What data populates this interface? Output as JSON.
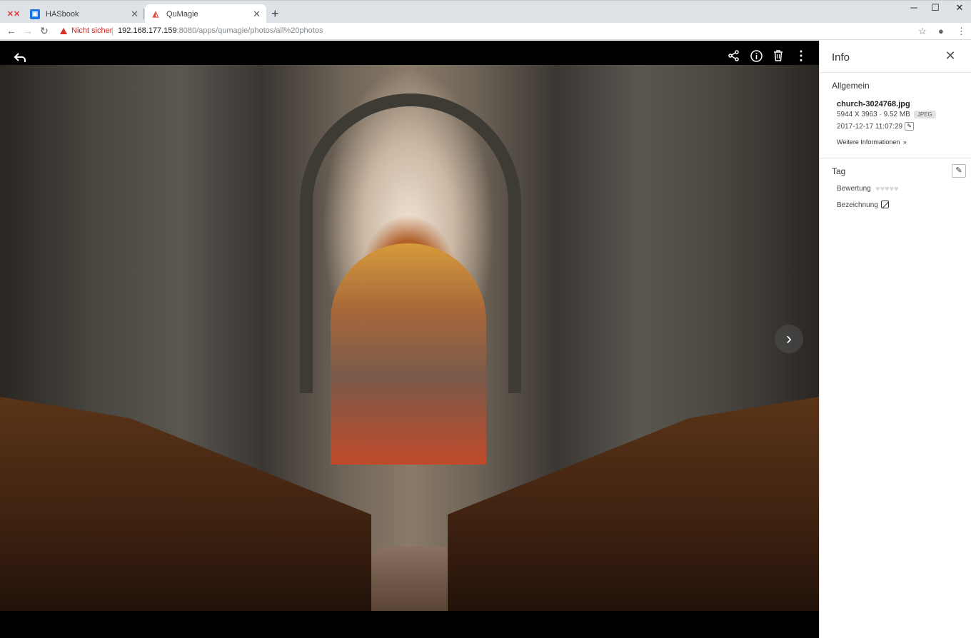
{
  "browser": {
    "tabs": [
      {
        "label": "",
        "icon": "xx-app-icon"
      },
      {
        "label": "HASbook",
        "icon": "hasbook-icon"
      },
      {
        "label": "QuMagie",
        "icon": "qumagie-icon"
      }
    ],
    "security_label": "Nicht sicher",
    "url_host": "192.168.177.159",
    "url_rest": ":8080/apps/qumagie/photos/all%20photos"
  },
  "viewer": {
    "image_subject": "church-interior",
    "next_icon": "chevron-right-icon"
  },
  "info_panel": {
    "title": "Info",
    "general_heading": "Allgemein",
    "file_name": "church-3024768.jpg",
    "dimensions_size": "5944 X 3963 · 9.52 MB",
    "format_badge": "JPEG",
    "datetime": "2017-12-17 11:07:29",
    "more_info": "Weitere Informationen",
    "tag_heading": "Tag",
    "rating_label": "Bewertung",
    "rating_value": 0,
    "rating_max": 5,
    "label_label": "Bezeichnung"
  },
  "colors": {
    "warning": "#d93025",
    "viewer_bg": "#000000",
    "panel_bg": "#ffffff"
  }
}
